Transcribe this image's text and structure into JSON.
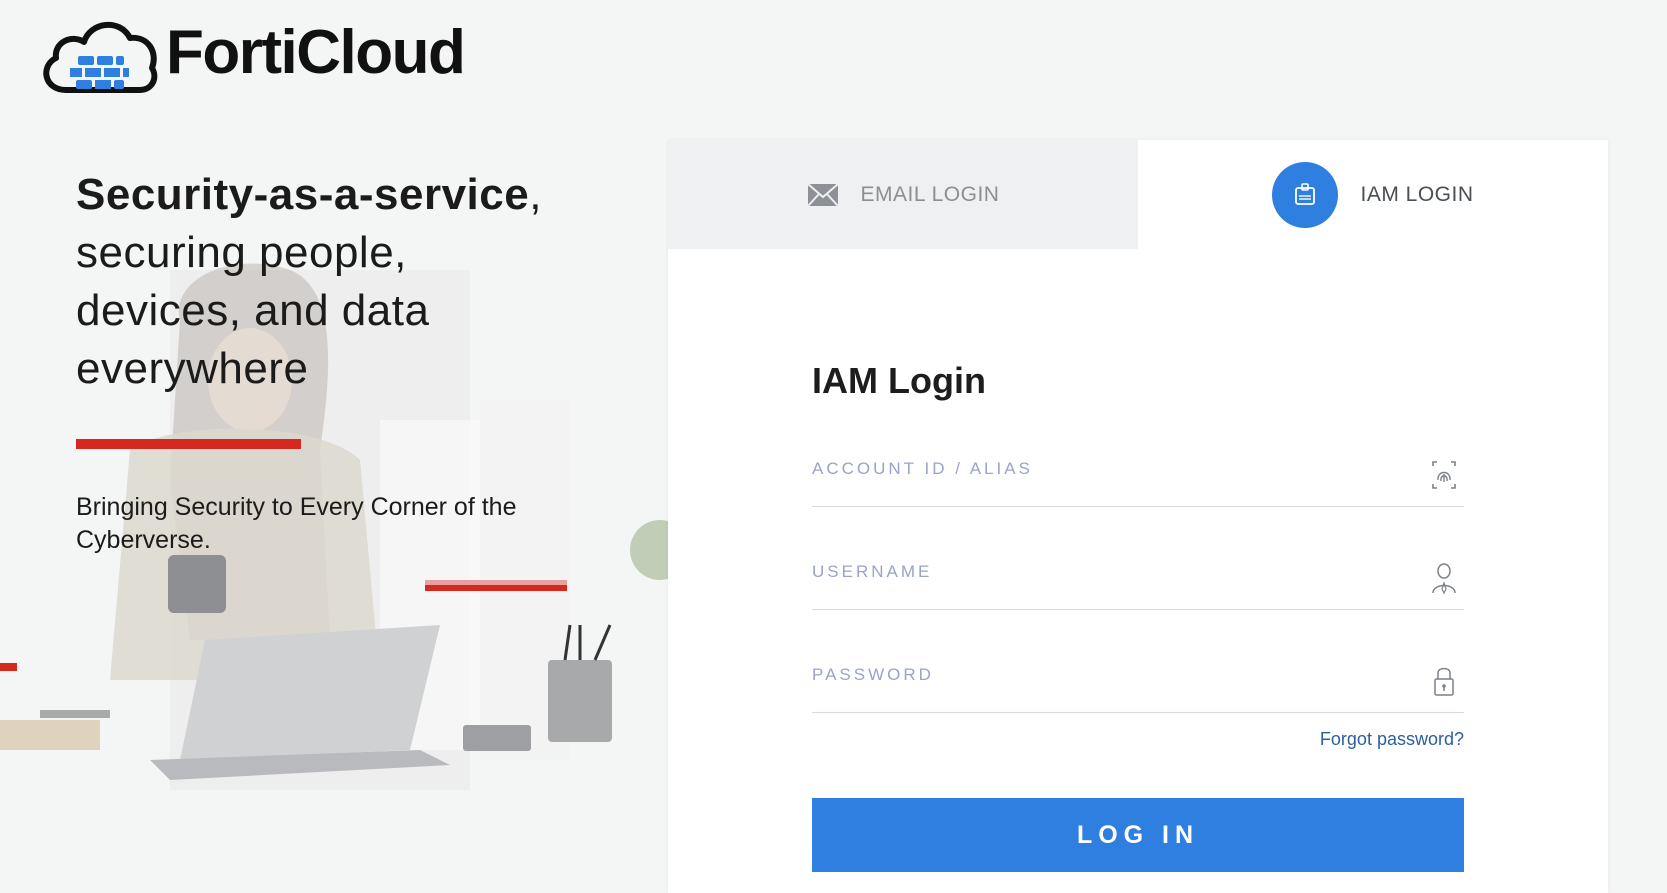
{
  "brand": {
    "name": "FortiCloud",
    "icon": "forticloud-logo-icon"
  },
  "hero": {
    "headline_bold": "Security-as-a-service",
    "headline_rest": ", securing people, devices, and data everywhere",
    "tagline": "Bringing Security to Every Corner of the Cyberverse."
  },
  "tabs": [
    {
      "label": "EMAIL LOGIN",
      "icon": "envelope-icon",
      "active": false
    },
    {
      "label": "IAM LOGIN",
      "icon": "iam-badge-icon",
      "active": true
    }
  ],
  "form": {
    "title": "IAM Login",
    "account_placeholder": "ACCOUNT ID / ALIAS",
    "username_placeholder": "USERNAME",
    "password_placeholder": "PASSWORD",
    "forgot_label": "Forgot password?",
    "login_label": "LOG IN"
  },
  "colors": {
    "accent": "#2f7fe0",
    "brand_red": "#d5281f",
    "link": "#2c5ea0"
  }
}
